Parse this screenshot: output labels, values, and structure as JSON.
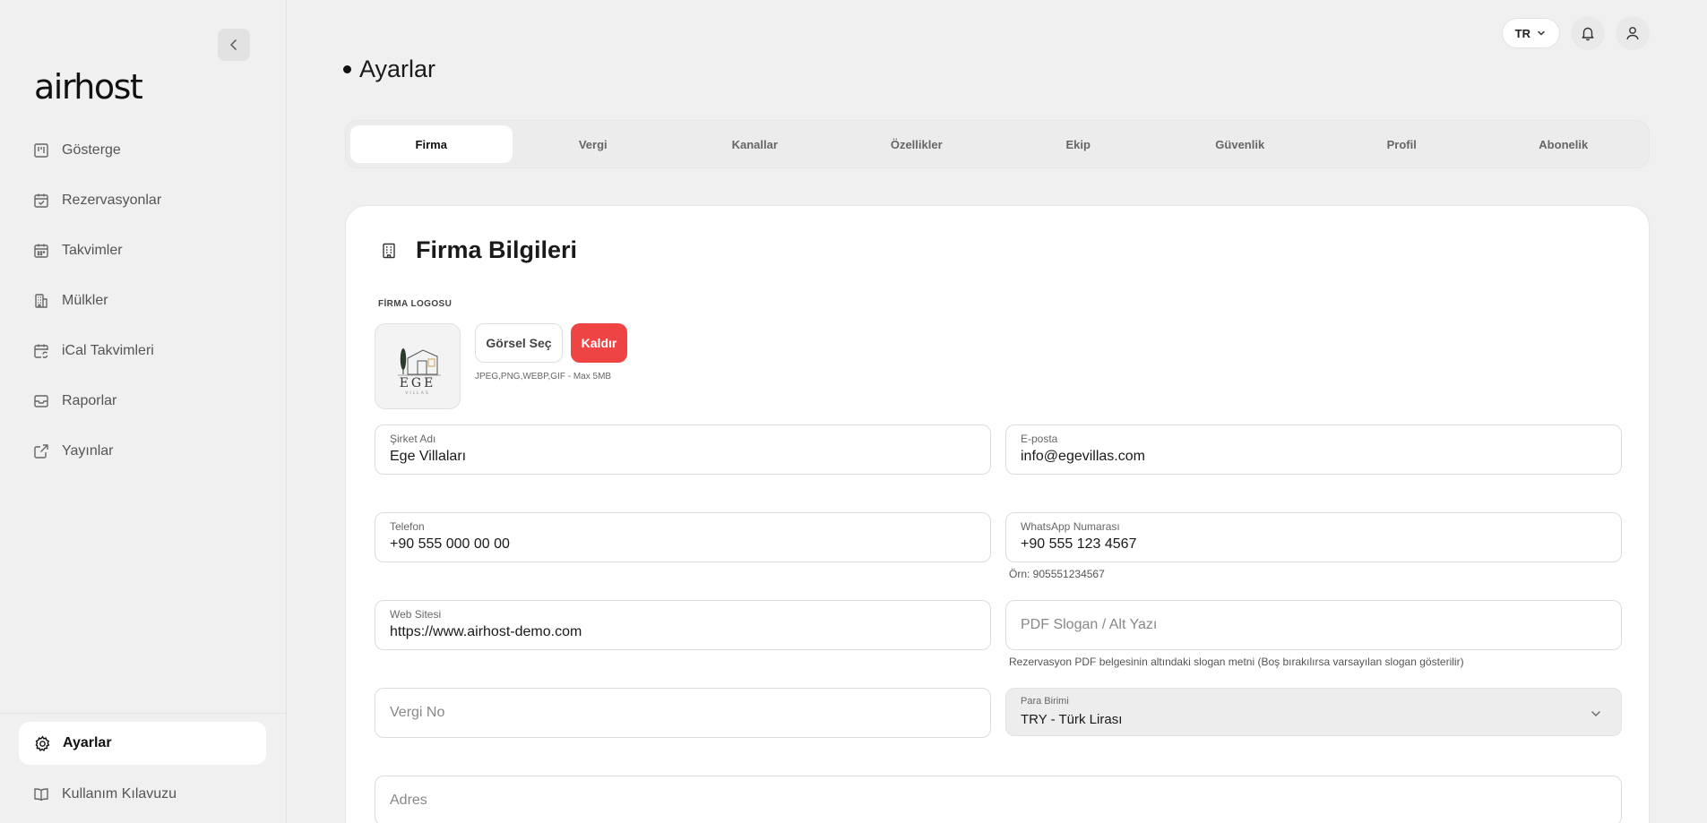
{
  "sidebar": {
    "logo": "airhost",
    "items": [
      {
        "label": "Gösterge",
        "icon": "dashboard-icon"
      },
      {
        "label": "Rezervasyonlar",
        "icon": "calendar-check-icon"
      },
      {
        "label": "Takvimler",
        "icon": "calendar-icon"
      },
      {
        "label": "Mülkler",
        "icon": "building-icon"
      },
      {
        "label": "iCal Takvimleri",
        "icon": "calendar-sync-icon"
      },
      {
        "label": "Raporlar",
        "icon": "inbox-icon"
      },
      {
        "label": "Yayınlar",
        "icon": "external-link-icon"
      }
    ],
    "active_item": "Ayarlar",
    "guide": "Kullanım Kılavuzu"
  },
  "header": {
    "lang": "TR",
    "page_title": "Ayarlar"
  },
  "tabs": [
    "Firma",
    "Vergi",
    "Kanallar",
    "Özellikler",
    "Ekip",
    "Güvenlik",
    "Profil",
    "Abonelik"
  ],
  "active_tab": "Firma",
  "card": {
    "title": "Firma Bilgileri",
    "logo_label": "FİRMA LOGOSU",
    "logo_text": "EGE",
    "logo_subtext": "VILLAS",
    "select_btn": "Görsel Seç",
    "remove_btn": "Kaldır",
    "file_hint": "JPEG,PNG,WEBP,GIF - Max 5MB",
    "company_name": {
      "label": "Şirket Adı",
      "value": "Ege Villaları"
    },
    "email": {
      "label": "E-posta",
      "value": "info@egevillas.com"
    },
    "phone": {
      "label": "Telefon",
      "value": "+90 555 000 00 00"
    },
    "whatsapp": {
      "label": "WhatsApp Numarası",
      "value": "+90 555 123 4567",
      "hint": "Örn: 905551234567"
    },
    "website": {
      "label": "Web Sitesi",
      "value": "https://www.airhost-demo.com"
    },
    "pdf_slogan": {
      "placeholder": "PDF Slogan / Alt Yazı",
      "hint": "Rezervasyon PDF belgesinin altındaki slogan metni (Boş bırakılırsa varsayılan slogan gösterilir)"
    },
    "tax_no": {
      "placeholder": "Vergi No"
    },
    "currency": {
      "label": "Para Birimi",
      "value": "TRY - Türk Lirası"
    },
    "address": {
      "placeholder": "Adres"
    }
  },
  "colors": {
    "danger": "#ef4444",
    "background": "#f0f0f0",
    "card": "#ffffff"
  }
}
